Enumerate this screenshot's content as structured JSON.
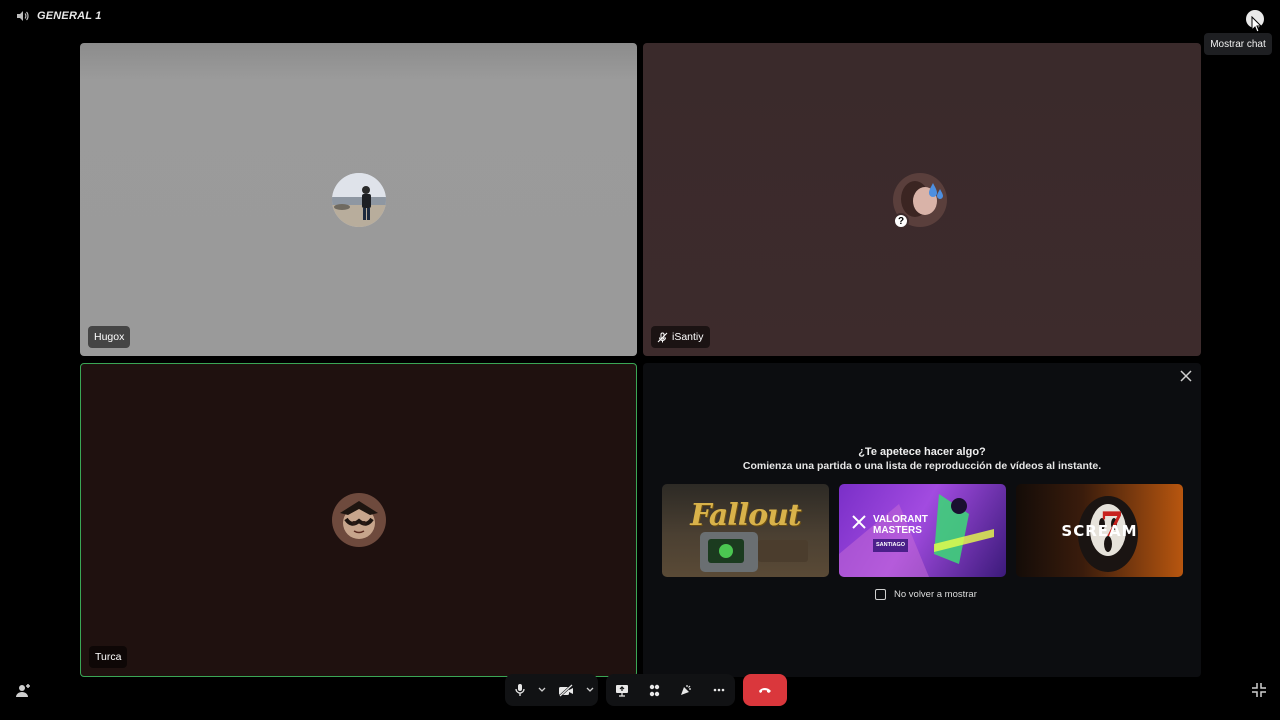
{
  "topbar": {
    "channel_name": "GENERAL 1",
    "chat_tooltip": "Mostrar chat"
  },
  "participants": [
    {
      "name": "Hugox",
      "muted": false
    },
    {
      "name": "iSantiy",
      "muted": true
    },
    {
      "name": "Turca",
      "muted": false,
      "speaking": true
    }
  ],
  "activity": {
    "title": "¿Te apetece hacer algo?",
    "subtitle": "Comienza una partida o una lista de reproducción de vídeos al instante.",
    "cards": [
      {
        "label": "Fallout"
      },
      {
        "label": "VALORANT MASTERS",
        "sublabel": "SANTIAGO"
      },
      {
        "label": "SCREAM"
      }
    ],
    "dont_show_label": "No volver a mostrar"
  },
  "controls": {
    "icons": [
      "microphone-icon",
      "camera-off-icon",
      "screen-share-icon",
      "activities-icon",
      "soundboard-icon",
      "more-icon",
      "hang-up-icon"
    ]
  },
  "colors": {
    "speaking_border": "#3aa655",
    "hangup": "#da373c"
  }
}
